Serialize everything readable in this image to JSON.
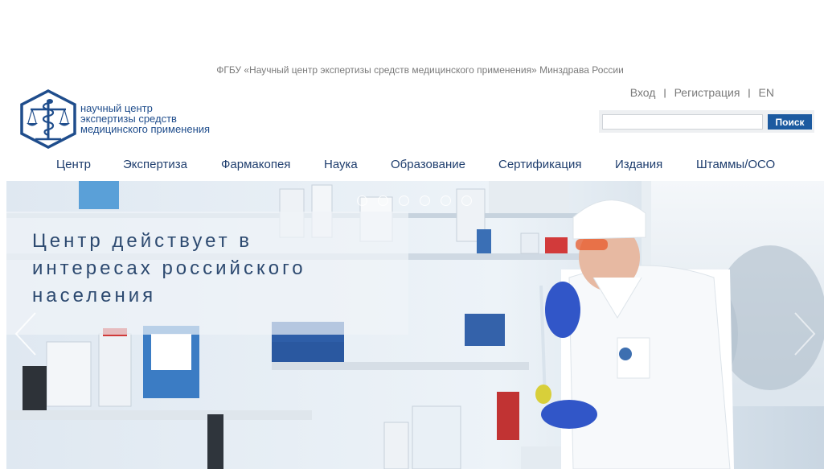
{
  "header": {
    "org_full_name": "ФГБУ «Научный центр экспертизы средств медицинского применения» Минздрава России",
    "logo_text": [
      "научный центр",
      "экспертизы средств",
      "медицинского применения"
    ],
    "logo_icon": "caduceus-scales-hexagon-icon"
  },
  "auth": {
    "login": "Вход",
    "separator": "|",
    "register": "Регистрация",
    "language": "EN"
  },
  "search": {
    "placeholder": "",
    "button_label": "Поиск"
  },
  "nav": {
    "items": [
      "Центр",
      "Экспертиза",
      "Фармакопея",
      "Наука",
      "Образование",
      "Сертификация",
      "Издания",
      "Штаммы/ОСО"
    ]
  },
  "slider": {
    "caption": "Центр действует в\nинтересах российского\nнаселения",
    "dots_count": 6,
    "active_dot": 0,
    "prev_icon": "chevron-left-icon",
    "next_icon": "chevron-right-icon"
  },
  "colors": {
    "brand_blue": "#1c5aa0",
    "nav_text": "#1f3e6e",
    "caption_text": "#2d4a70"
  }
}
